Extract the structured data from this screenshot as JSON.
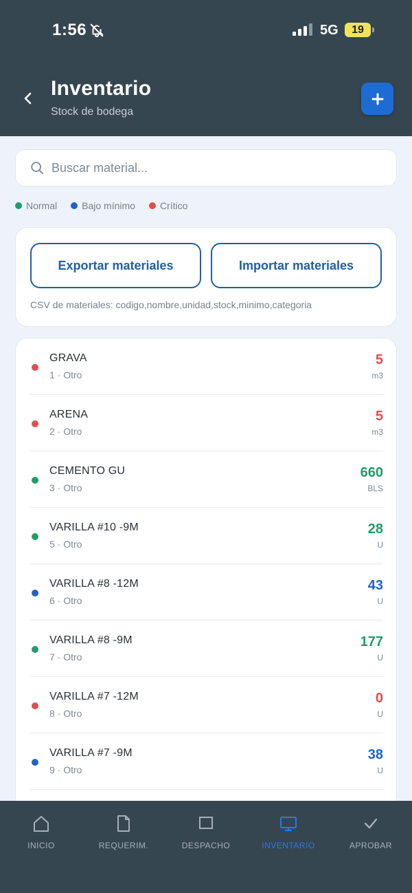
{
  "status": {
    "time": "1:56",
    "network": "5G",
    "battery": "19"
  },
  "header": {
    "title": "Inventario",
    "subtitle": "Stock de bodega"
  },
  "search": {
    "placeholder": "Buscar material...",
    "value": ""
  },
  "legend": [
    {
      "label": "Normal",
      "color": "#1f9d6b"
    },
    {
      "label": "Bajo mínimo",
      "color": "#1f63c6"
    },
    {
      "label": "Crítico",
      "color": "#e0504a"
    }
  ],
  "csv": {
    "export_label": "Exportar materiales",
    "import_label": "Importar materiales",
    "hint": "CSV de materiales: codigo,nombre,unidad,stock,minimo,categoria"
  },
  "colors": {
    "critical": "#e0504a",
    "normal": "#1f9d6b",
    "low": "#1f63c6",
    "accent": "#1f6bd4",
    "header_bg": "#364651"
  },
  "materials": [
    {
      "name": "GRAVA",
      "sub": "1 · Otro",
      "qty": "5",
      "unit": "m3",
      "status": "critical"
    },
    {
      "name": "ARENA",
      "sub": "2 · Otro",
      "qty": "5",
      "unit": "m3",
      "status": "critical"
    },
    {
      "name": "CEMENTO GU",
      "sub": "3 · Otro",
      "qty": "660",
      "unit": "BLS",
      "status": "normal"
    },
    {
      "name": "VARILLA #10 -9M",
      "sub": "5 · Otro",
      "qty": "28",
      "unit": "U",
      "status": "normal"
    },
    {
      "name": "VARILLA #8 -12M",
      "sub": "6 · Otro",
      "qty": "43",
      "unit": "U",
      "status": "low"
    },
    {
      "name": "VARILLA #8 -9M",
      "sub": "7 · Otro",
      "qty": "177",
      "unit": "U",
      "status": "normal"
    },
    {
      "name": "VARILLA #7 -12M",
      "sub": "8 · Otro",
      "qty": "0",
      "unit": "U",
      "status": "critical"
    },
    {
      "name": "VARILLA #7 -9M",
      "sub": "9 · Otro",
      "qty": "38",
      "unit": "U",
      "status": "low"
    }
  ],
  "nav": [
    {
      "label": "INICIO",
      "icon": "home-icon",
      "active": false
    },
    {
      "label": "REQUERIM.",
      "icon": "document-icon",
      "active": false
    },
    {
      "label": "DESPACHO",
      "icon": "box-icon",
      "active": false
    },
    {
      "label": "INVENTARIO",
      "icon": "monitor-icon",
      "active": true
    },
    {
      "label": "APROBAR",
      "icon": "check-icon",
      "active": false
    }
  ]
}
